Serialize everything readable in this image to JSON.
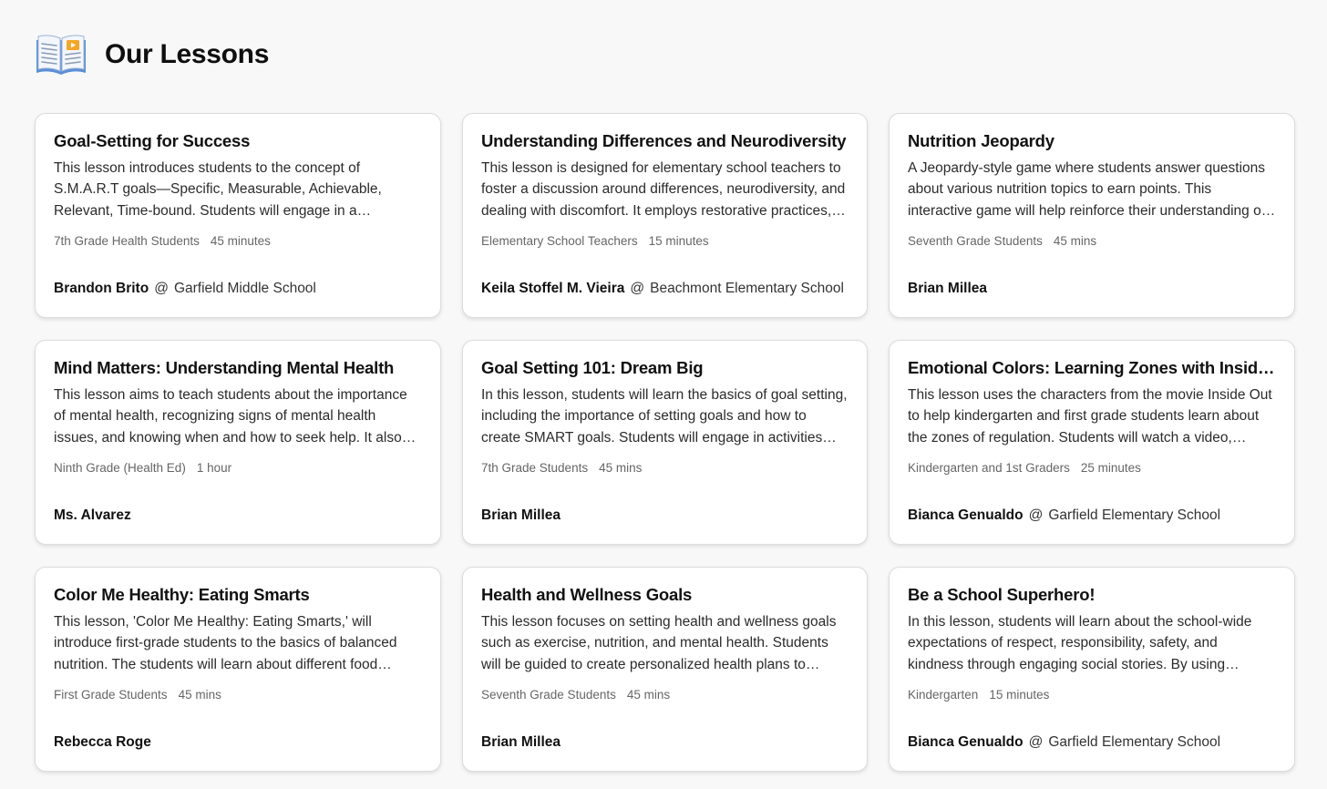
{
  "header": {
    "title": "Our Lessons",
    "icon": "open-book-icon"
  },
  "lessons": [
    {
      "title": "Goal-Setting for Success",
      "description": "This lesson introduces students to the concept of S.M.A.R.T goals—Specific, Measurable, Achievable, Relevant, Time-bound. Students will engage in a discussion, watch a…",
      "audience": "7th Grade Health Students",
      "duration": "45 minutes",
      "author": "Brandon Brito",
      "at": "@",
      "school": "Garfield Middle School"
    },
    {
      "title": "Understanding Differences and Neurodiversity",
      "description": "This lesson is designed for elementary school teachers to foster a discussion around differences, neurodiversity, and dealing with discomfort. It employs restorative practices,…",
      "audience": "Elementary School Teachers",
      "duration": "15 minutes",
      "author": "Keila Stoffel M. Vieira",
      "at": "@",
      "school": "Beachmont Elementary School"
    },
    {
      "title": "Nutrition Jeopardy",
      "description": "A Jeopardy-style game where students answer questions about various nutrition topics to earn points. This interactive game will help reinforce their understanding o…",
      "audience": "Seventh Grade Students",
      "duration": "45 mins",
      "author": "Brian Millea",
      "at": "",
      "school": ""
    },
    {
      "title": "Mind Matters: Understanding Mental Health",
      "description": "This lesson aims to teach students about the importance of mental health, recognizing signs of mental health issues, and knowing when and how to seek help. It also emphasiz…",
      "audience": "Ninth Grade (Health Ed)",
      "duration": "1 hour",
      "author": "Ms. Alvarez",
      "at": "",
      "school": ""
    },
    {
      "title": "Goal Setting 101: Dream Big",
      "description": "In this lesson, students will learn the basics of goal setting, including the importance of setting goals and how to create SMART goals. Students will engage in activities that help…",
      "audience": "7th Grade Students",
      "duration": "45 mins",
      "author": "Brian Millea",
      "at": "",
      "school": ""
    },
    {
      "title": "Emotional Colors: Learning Zones with Inside Out",
      "description": "This lesson uses the characters from the movie Inside Out to help kindergarten and first grade students learn about the zones of regulation. Students will watch a video, discu…",
      "audience": "Kindergarten and 1st Graders",
      "duration": "25 minutes",
      "author": "Bianca Genualdo",
      "at": "@",
      "school": "Garfield Elementary School"
    },
    {
      "title": "Color Me Healthy: Eating Smarts",
      "description": "This lesson, 'Color Me Healthy: Eating Smarts,' will introduce first-grade students to the basics of balanced nutrition. The students will learn about different food…",
      "audience": "First Grade Students",
      "duration": "45 mins",
      "author": "Rebecca Roge",
      "at": "",
      "school": ""
    },
    {
      "title": "Health and Wellness Goals",
      "description": "This lesson focuses on setting health and wellness goals such as exercise, nutrition, and mental health. Students will be guided to create personalized health plans to support…",
      "audience": "Seventh Grade Students",
      "duration": "45 mins",
      "author": "Brian Millea",
      "at": "",
      "school": ""
    },
    {
      "title": "Be a School Superhero!",
      "description": "In this lesson, students will learn about the school-wide expectations of respect, responsibility, safety, and kindness through engaging social stories. By using bilingual one-pa…",
      "audience": "Kindergarten",
      "duration": "15 minutes",
      "author": "Bianca Genualdo",
      "at": "@",
      "school": "Garfield Elementary School"
    }
  ]
}
